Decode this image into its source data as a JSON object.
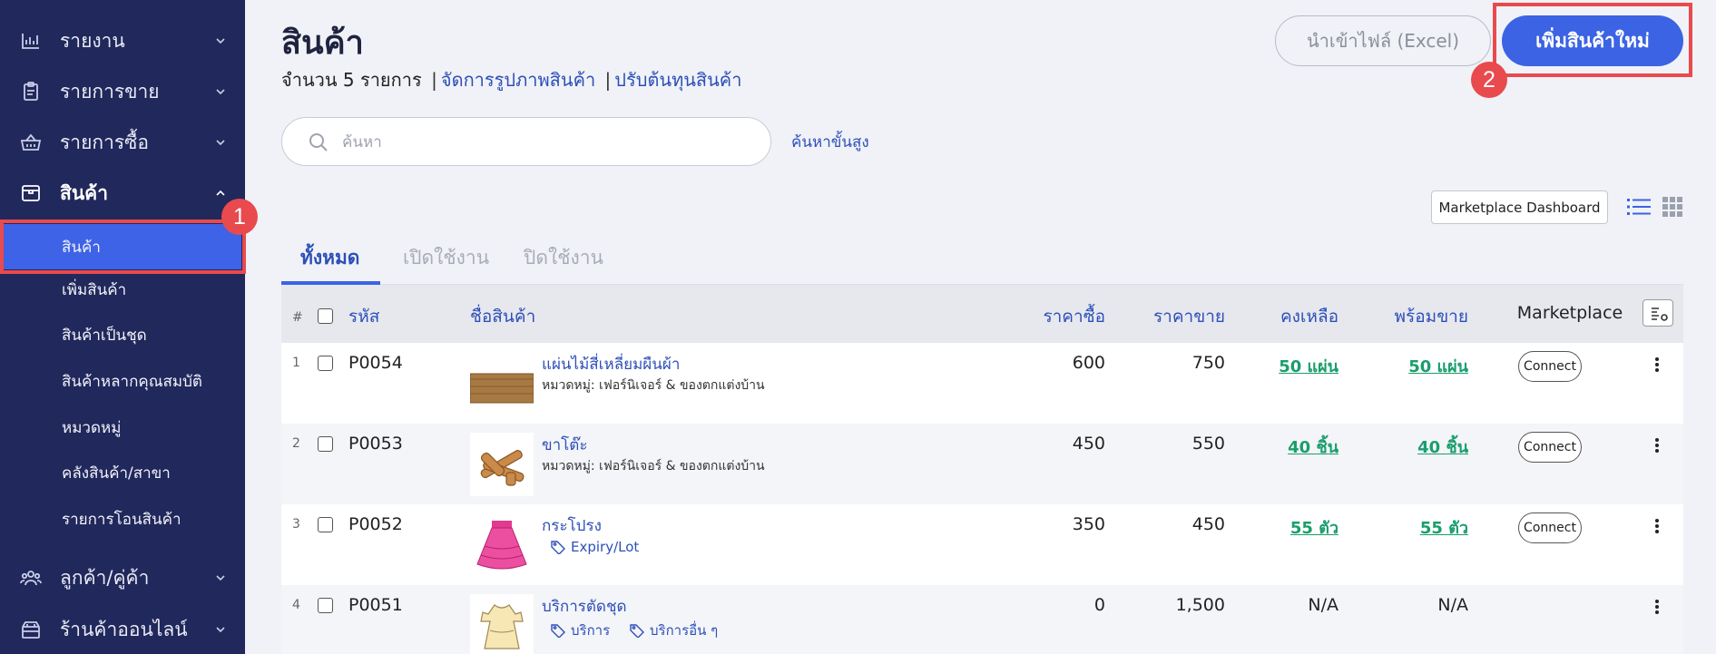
{
  "sidebar": {
    "items": [
      {
        "label": "รายงาน",
        "icon": "chart-icon"
      },
      {
        "label": "รายการขาย",
        "icon": "clipboard-icon"
      },
      {
        "label": "รายการซื้อ",
        "icon": "basket-icon"
      },
      {
        "label": "สินค้า",
        "icon": "box-icon"
      },
      {
        "label": "ลูกค้า/คู่ค้า",
        "icon": "users-icon"
      },
      {
        "label": "ร้านค้าออนไลน์",
        "icon": "store-icon"
      }
    ],
    "subitems": [
      "สินค้า",
      "เพิ่มสินค้า",
      "สินค้าเป็นชุด",
      "สินค้าหลากคุณสมบัติ",
      "หมวดหมู่",
      "คลังสินค้า/สาขา",
      "รายการโอนสินค้า"
    ]
  },
  "annotations": {
    "badge1": "1",
    "badge2": "2",
    "color": "#e84a4d"
  },
  "header": {
    "title": "สินค้า",
    "count_text": "จำนวน 5 รายการ",
    "sep": "|",
    "link_images": "จัดการรูปภาพสินค้า",
    "link_cost": "ปรับต้นทุนสินค้า",
    "import_label": "นำเข้าไฟล์ (Excel)",
    "add_label": "เพิ่มสินค้าใหม่"
  },
  "search": {
    "placeholder": "ค้นหา",
    "value": "",
    "advanced_label": "ค้นหาขั้นสูง"
  },
  "toolbar": {
    "marketplace_dashboard": "Marketplace Dashboard"
  },
  "tabs": [
    {
      "label": "ทั้งหมด",
      "active": true
    },
    {
      "label": "เปิดใช้งาน",
      "active": false
    },
    {
      "label": "ปิดใช้งาน",
      "active": false
    }
  ],
  "table": {
    "columns": {
      "num": "#",
      "code": "รหัส",
      "name": "ชื่อสินค้า",
      "buy": "ราคาซื้อ",
      "sell": "ราคาขาย",
      "remaining": "คงเหลือ",
      "available": "พร้อมขาย",
      "marketplace": "Marketplace"
    },
    "rows": [
      {
        "n": "1",
        "code": "P0054",
        "name": "แผ่นไม้สี่เหลี่ยมผืนผ้า",
        "category": "หมวดหมู่: เฟอร์นิเจอร์ & ของตกแต่งบ้าน",
        "tags": [],
        "buy": "600",
        "sell": "750",
        "remaining": "50 แผ่น",
        "available": "50 แผ่น",
        "connect": "Connect",
        "thumb": "wood"
      },
      {
        "n": "2",
        "code": "P0053",
        "name": "ขาโต๊ะ",
        "category": "หมวดหมู่: เฟอร์นิเจอร์ & ของตกแต่งบ้าน",
        "tags": [],
        "buy": "450",
        "sell": "550",
        "remaining": "40 ชิ้น",
        "available": "40 ชิ้น",
        "connect": "Connect",
        "thumb": "legs"
      },
      {
        "n": "3",
        "code": "P0052",
        "name": "กระโปรง",
        "category": "",
        "tags": [
          "Expiry/Lot"
        ],
        "buy": "350",
        "sell": "450",
        "remaining": "55 ตัว",
        "available": "55 ตัว",
        "connect": "Connect",
        "thumb": "skirt"
      },
      {
        "n": "4",
        "code": "P0051",
        "name": "บริการตัดชุด",
        "category": "",
        "tags": [
          "บริการ",
          "บริการอื่น ๆ"
        ],
        "buy": "0",
        "sell": "1,500",
        "remaining": "N/A",
        "available": "N/A",
        "connect": "",
        "thumb": "dress"
      }
    ]
  }
}
